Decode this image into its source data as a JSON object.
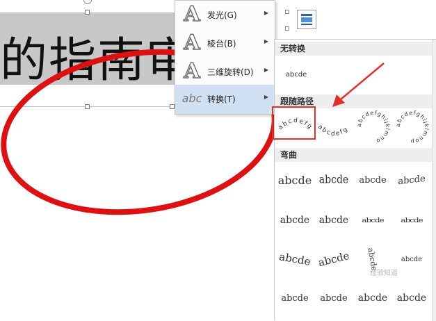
{
  "document": {
    "wordart_text": "的指南审核"
  },
  "side_menu": {
    "items": [
      {
        "label": "发光(G)",
        "icon": "A-glow-icon"
      },
      {
        "label": "棱台(B)",
        "icon": "A-bevel-icon"
      },
      {
        "label": "三维旋转(D)",
        "icon": "A-3d-rotation-icon"
      },
      {
        "label": "转换(T)",
        "icon": "abc-transform-icon",
        "active": true
      }
    ]
  },
  "gallery": {
    "section_no_transform": "无转换",
    "no_transform_sample": "abcde",
    "section_follow_path": "跟随路径",
    "path_samples": [
      "abcdefg",
      "abcdefg",
      "abcdefghijklmno",
      "abcdefghijklmnop"
    ],
    "section_warp": "弯曲",
    "warp_samples": [
      "abcde",
      "abcde",
      "abcde",
      "abcde",
      "abcde",
      "abcde",
      "abcde",
      "abcde",
      "abcde",
      "abcde",
      "abcde",
      "abcde",
      "abcde",
      "abcde",
      "abcde",
      "abcde"
    ]
  },
  "watermark": "经验知道",
  "colors": {
    "highlight": "#e0302a",
    "ellipse": "#dd1111",
    "active_menu_bg": "#cfe0f3"
  }
}
